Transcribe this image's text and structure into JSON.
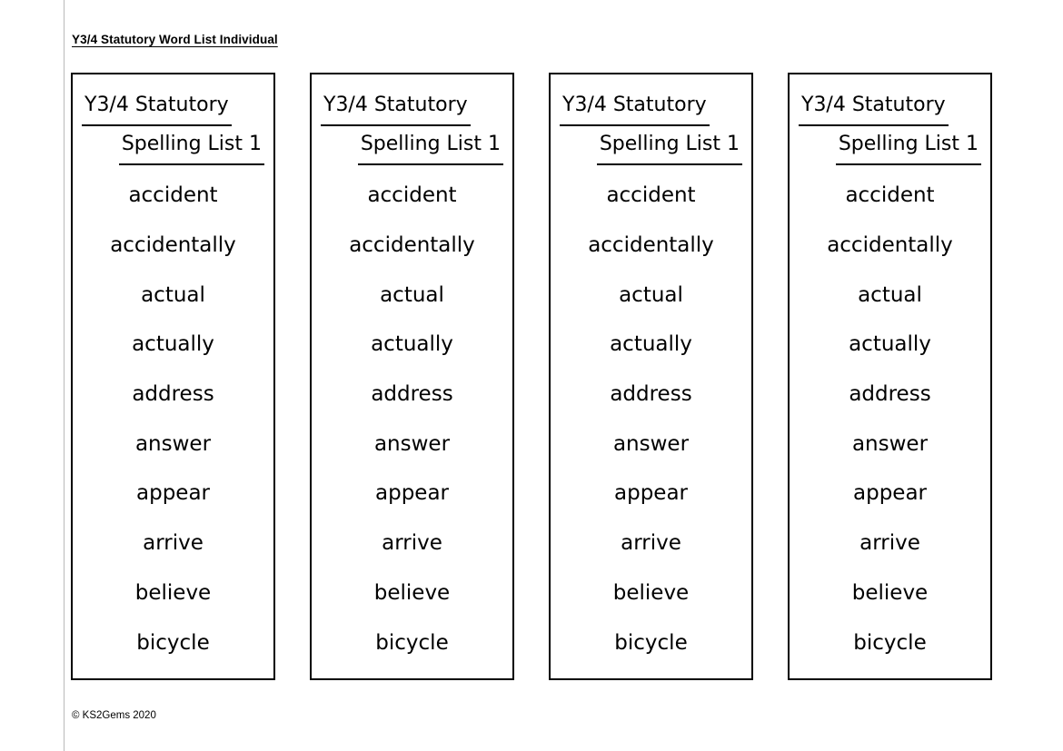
{
  "document": {
    "header_title": "Y3/4 Statutory Word List Individual",
    "footer_credit": "© KS2Gems 2020"
  },
  "card_template": {
    "title_line_1": "Y3/4 Statutory",
    "title_line_2": "Spelling List 1",
    "words": [
      "accident",
      "accidentally",
      "actual",
      "actually",
      "address",
      "answer",
      "appear",
      "arrive",
      "believe",
      "bicycle"
    ]
  },
  "cards": [
    {
      "index": 1,
      "title_line_1": "Y3/4 Statutory",
      "title_line_2": "Spelling List 1",
      "words": [
        "accident",
        "accidentally",
        "actual",
        "actually",
        "address",
        "answer",
        "appear",
        "arrive",
        "believe",
        "bicycle"
      ]
    },
    {
      "index": 2,
      "title_line_1": "Y3/4 Statutory",
      "title_line_2": "Spelling List 1",
      "words": [
        "accident",
        "accidentally",
        "actual",
        "actually",
        "address",
        "answer",
        "appear",
        "arrive",
        "believe",
        "bicycle"
      ]
    },
    {
      "index": 3,
      "title_line_1": "Y3/4 Statutory",
      "title_line_2": "Spelling List 1",
      "words": [
        "accident",
        "accidentally",
        "actual",
        "actually",
        "address",
        "answer",
        "appear",
        "arrive",
        "believe",
        "bicycle"
      ]
    },
    {
      "index": 4,
      "title_line_1": "Y3/4 Statutory",
      "title_line_2": "Spelling List 1",
      "words": [
        "accident",
        "accidentally",
        "actual",
        "actually",
        "address",
        "answer",
        "appear",
        "arrive",
        "believe",
        "bicycle"
      ]
    }
  ],
  "colors": {
    "ink": "#000000",
    "page": "#ffffff",
    "margin_guide": "#b9b9b9"
  }
}
